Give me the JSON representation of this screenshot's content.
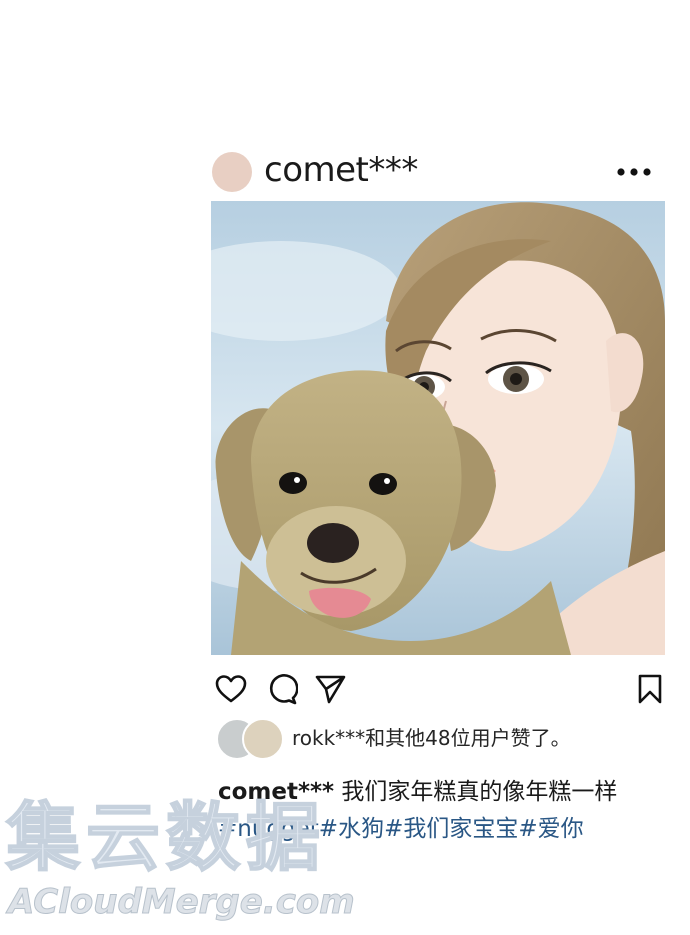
{
  "post": {
    "username": "comet***",
    "more_icon": "more-horizontal-icon",
    "photo_alt": "",
    "actions": {
      "like_icon": "heart-icon",
      "comment_icon": "comment-icon",
      "share_icon": "send-icon",
      "save_icon": "bookmark-icon"
    },
    "likes_text": "rokk***和其他48位用户赞了。",
    "caption_user": "comet***",
    "caption_text": "我们家年糕真的像年糕一样",
    "hashtags": "#nugget#水狗#我们家宝宝#爱你"
  },
  "watermark": {
    "cn": "集云数据",
    "en": "ACloudMerge.com"
  },
  "colors": {
    "background": "#ffffff",
    "avatar": "#e8cfc3",
    "hashtag": "#2a5785",
    "watermark": "#c6d1dd"
  }
}
